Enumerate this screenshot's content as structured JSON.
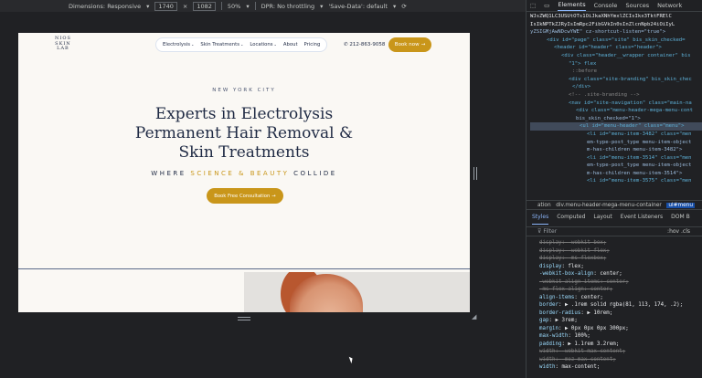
{
  "devtools_toolbar": {
    "dimensions_label": "Dimensions: Responsive",
    "width": "1740",
    "times": "×",
    "height": "1082",
    "zoom": "50%",
    "dpr": "DPR: No throttling",
    "save_data": "'Save-Data': default"
  },
  "site": {
    "logo_lines": [
      "NIOS",
      "SKIN",
      "LAB"
    ],
    "menu": [
      "Electrolysis",
      "Skin Treatments",
      "Locations",
      "About",
      "Pricing"
    ],
    "phone": "212-863-9058",
    "book_now": "Book now",
    "eyebrow": "NEW YORK CITY",
    "headline_lines": [
      "Experts in Electrolysis",
      "Permanent Hair Removal &",
      "Skin Treatments"
    ],
    "tagline_pre": "WHERE",
    "tagline_gold": "SCIENCE & BEAUTY",
    "tagline_post": "COLLIDE",
    "consult_button": "Book Free Consultation"
  },
  "devtools": {
    "tabs": [
      "Elements",
      "Console",
      "Sources",
      "Network"
    ],
    "dom_lines": [
      "WJsZWQ1LC3USUtOTs1OiJkaXNhYmxlZCIsIkx3TktFRElC",
      "IsIkNPTkZJRyIsImRpc2FibGVkIn0sInZlcnNpb24iOiIyL",
      "yZSIGMjAwNDcwYWE\" cz-shortcut-listen=\"true\">",
      "<div id=\"page\" class=\"site\" bis_skin_checked=",
      "<header id=\"header\" class=\"header\">",
      "<div class=\"header__wrapper container\" bis",
      "\"1\">  flex",
      "::before",
      "<div class=\"site-branding\" bis_skin_chec",
      "</div>",
      "<!-- .site-branding -->",
      "<nav id=\"site-navigation\" class=\"main-na",
      "<div class=\"menu-header-mega-menu-cont",
      "bis_skin_checked=\"1\">",
      "<ul id=\"menu-header\" class=\"menu\">",
      "<li id=\"menu-item-3482\" class=\"men",
      "em-type-post_type menu-item-object",
      "m-has-children menu-item-3482\">",
      "<li id=\"menu-item-3514\" class=\"men",
      "em-type-post_type menu-item-object",
      "m-has-children menu-item-3514\">",
      "<li id=\"menu-item-3575\" class=\"men"
    ],
    "breadcrumb": [
      "ation",
      "div.menu-header-mega-menu-container",
      "ul#menu"
    ],
    "subtabs": [
      "Styles",
      "Computed",
      "Layout",
      "Event Listeners",
      "DOM B"
    ],
    "filter_placeholder": "Filter",
    "filter_hov": ":hov .cls",
    "styles": [
      {
        "p": "display",
        "v": "-webkit-box;",
        "s": true
      },
      {
        "p": "display",
        "v": "-webkit-flex;",
        "s": true
      },
      {
        "p": "display",
        "v": "-ms-flexbox;",
        "s": true
      },
      {
        "p": "display",
        "v": "flex;",
        "s": false
      },
      {
        "p": "-webkit-box-align",
        "v": "center;",
        "s": false
      },
      {
        "p": "-webkit-align-items",
        "v": "center;",
        "s": true
      },
      {
        "p": "-ms-flex-align",
        "v": "center;",
        "s": true
      },
      {
        "p": "align-items",
        "v": "center;",
        "s": false
      },
      {
        "p": "border",
        "v": "▶ .1rem solid rgba(81, 113, 174, .2);",
        "s": false
      },
      {
        "p": "border-radius",
        "v": "▶ 10rem;",
        "s": false
      },
      {
        "p": "gap",
        "v": "▶ 3rem;",
        "s": false
      },
      {
        "p": "margin",
        "v": "▶ 0px 0px 0px 300px;",
        "s": false
      },
      {
        "p": "max-width",
        "v": "100%;",
        "s": false
      },
      {
        "p": "padding",
        "v": "▶ 1.1rem 3.2rem;",
        "s": false
      },
      {
        "p": "width",
        "v": "-webkit-max-content;",
        "s": true
      },
      {
        "p": "width",
        "v": "-moz-max-content;",
        "s": true
      },
      {
        "p": "width",
        "v": "max-content;",
        "s": false
      }
    ]
  }
}
